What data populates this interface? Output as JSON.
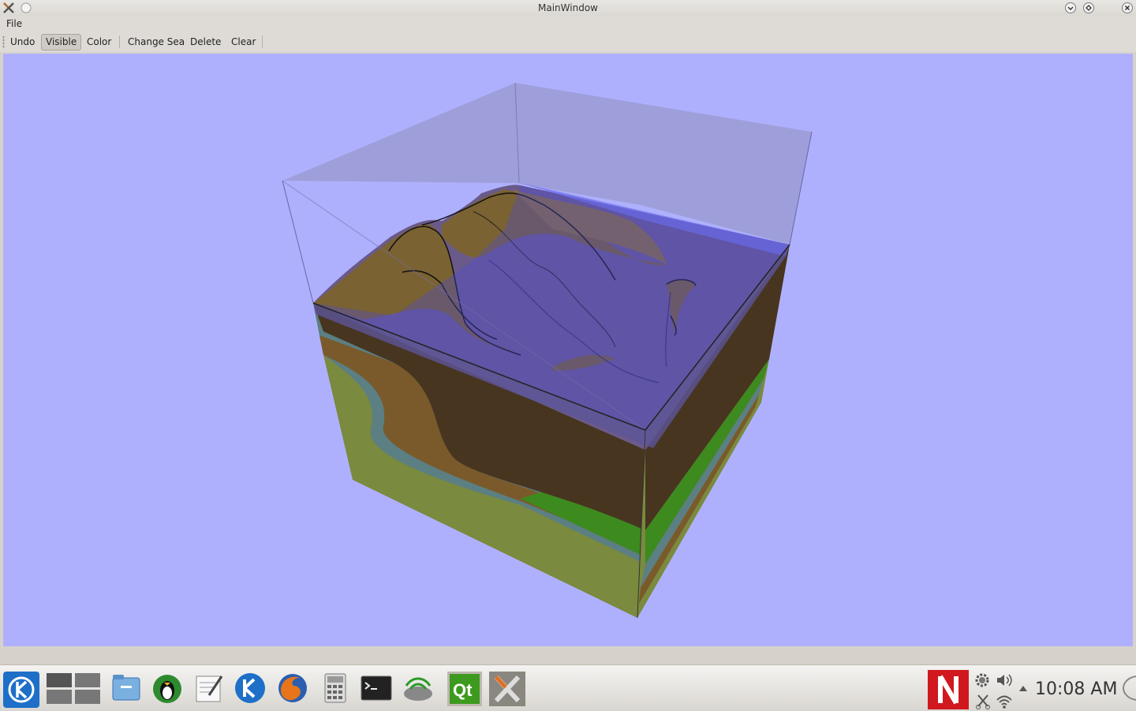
{
  "window": {
    "title": "MainWindow"
  },
  "menu": {
    "file": "File"
  },
  "toolbar": {
    "undo": "Undo",
    "visible": "Visible",
    "color": "Color",
    "change_sea": "Change Sea",
    "delete": "Delete",
    "clear": "Clear"
  },
  "viewport": {
    "background": "#afb0fd"
  },
  "taskbar": {
    "clock": "10:08 AM",
    "launchers": [
      "kde-menu-icon",
      "desktop-pager-icon",
      "file-manager-icon",
      "tux-icon",
      "text-editor-icon",
      "kde-app-icon",
      "firefox-icon",
      "calculator-icon",
      "terminal-icon",
      "network-icon",
      "qt-creator-icon",
      "x-app-icon"
    ],
    "tray": [
      "netflix-icon",
      "settings-icon",
      "volume-icon",
      "scissors-icon",
      "wifi-icon"
    ]
  }
}
